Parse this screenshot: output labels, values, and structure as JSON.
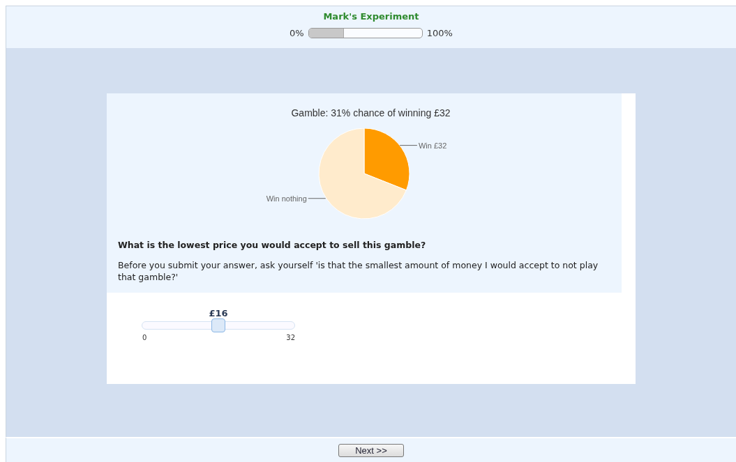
{
  "header": {
    "title": "Mark's Experiment",
    "progress": {
      "start_label": "0%",
      "end_label": "100%",
      "level": 0.31
    }
  },
  "question": {
    "chart_data": {
      "type": "pie",
      "title": "Gamble: 31% chance of winning £32",
      "categories": [
        "Win £32",
        "Win nothing"
      ],
      "series": [
        {
          "values": [
            31,
            69
          ],
          "colors": [
            "#ff9b00",
            "#ffebcc"
          ]
        }
      ]
    },
    "prompt": "What is the lowest price you would accept to sell this gamble?",
    "instruction": "Before you submit your answer, ask yourself 'is that the smallest amount of money I would accept to not play that gamble?'",
    "slider": {
      "value_label": "£16",
      "min_label": "0",
      "max_label": "32",
      "level": 0.5
    }
  },
  "footer": {
    "button": "Next >>"
  }
}
